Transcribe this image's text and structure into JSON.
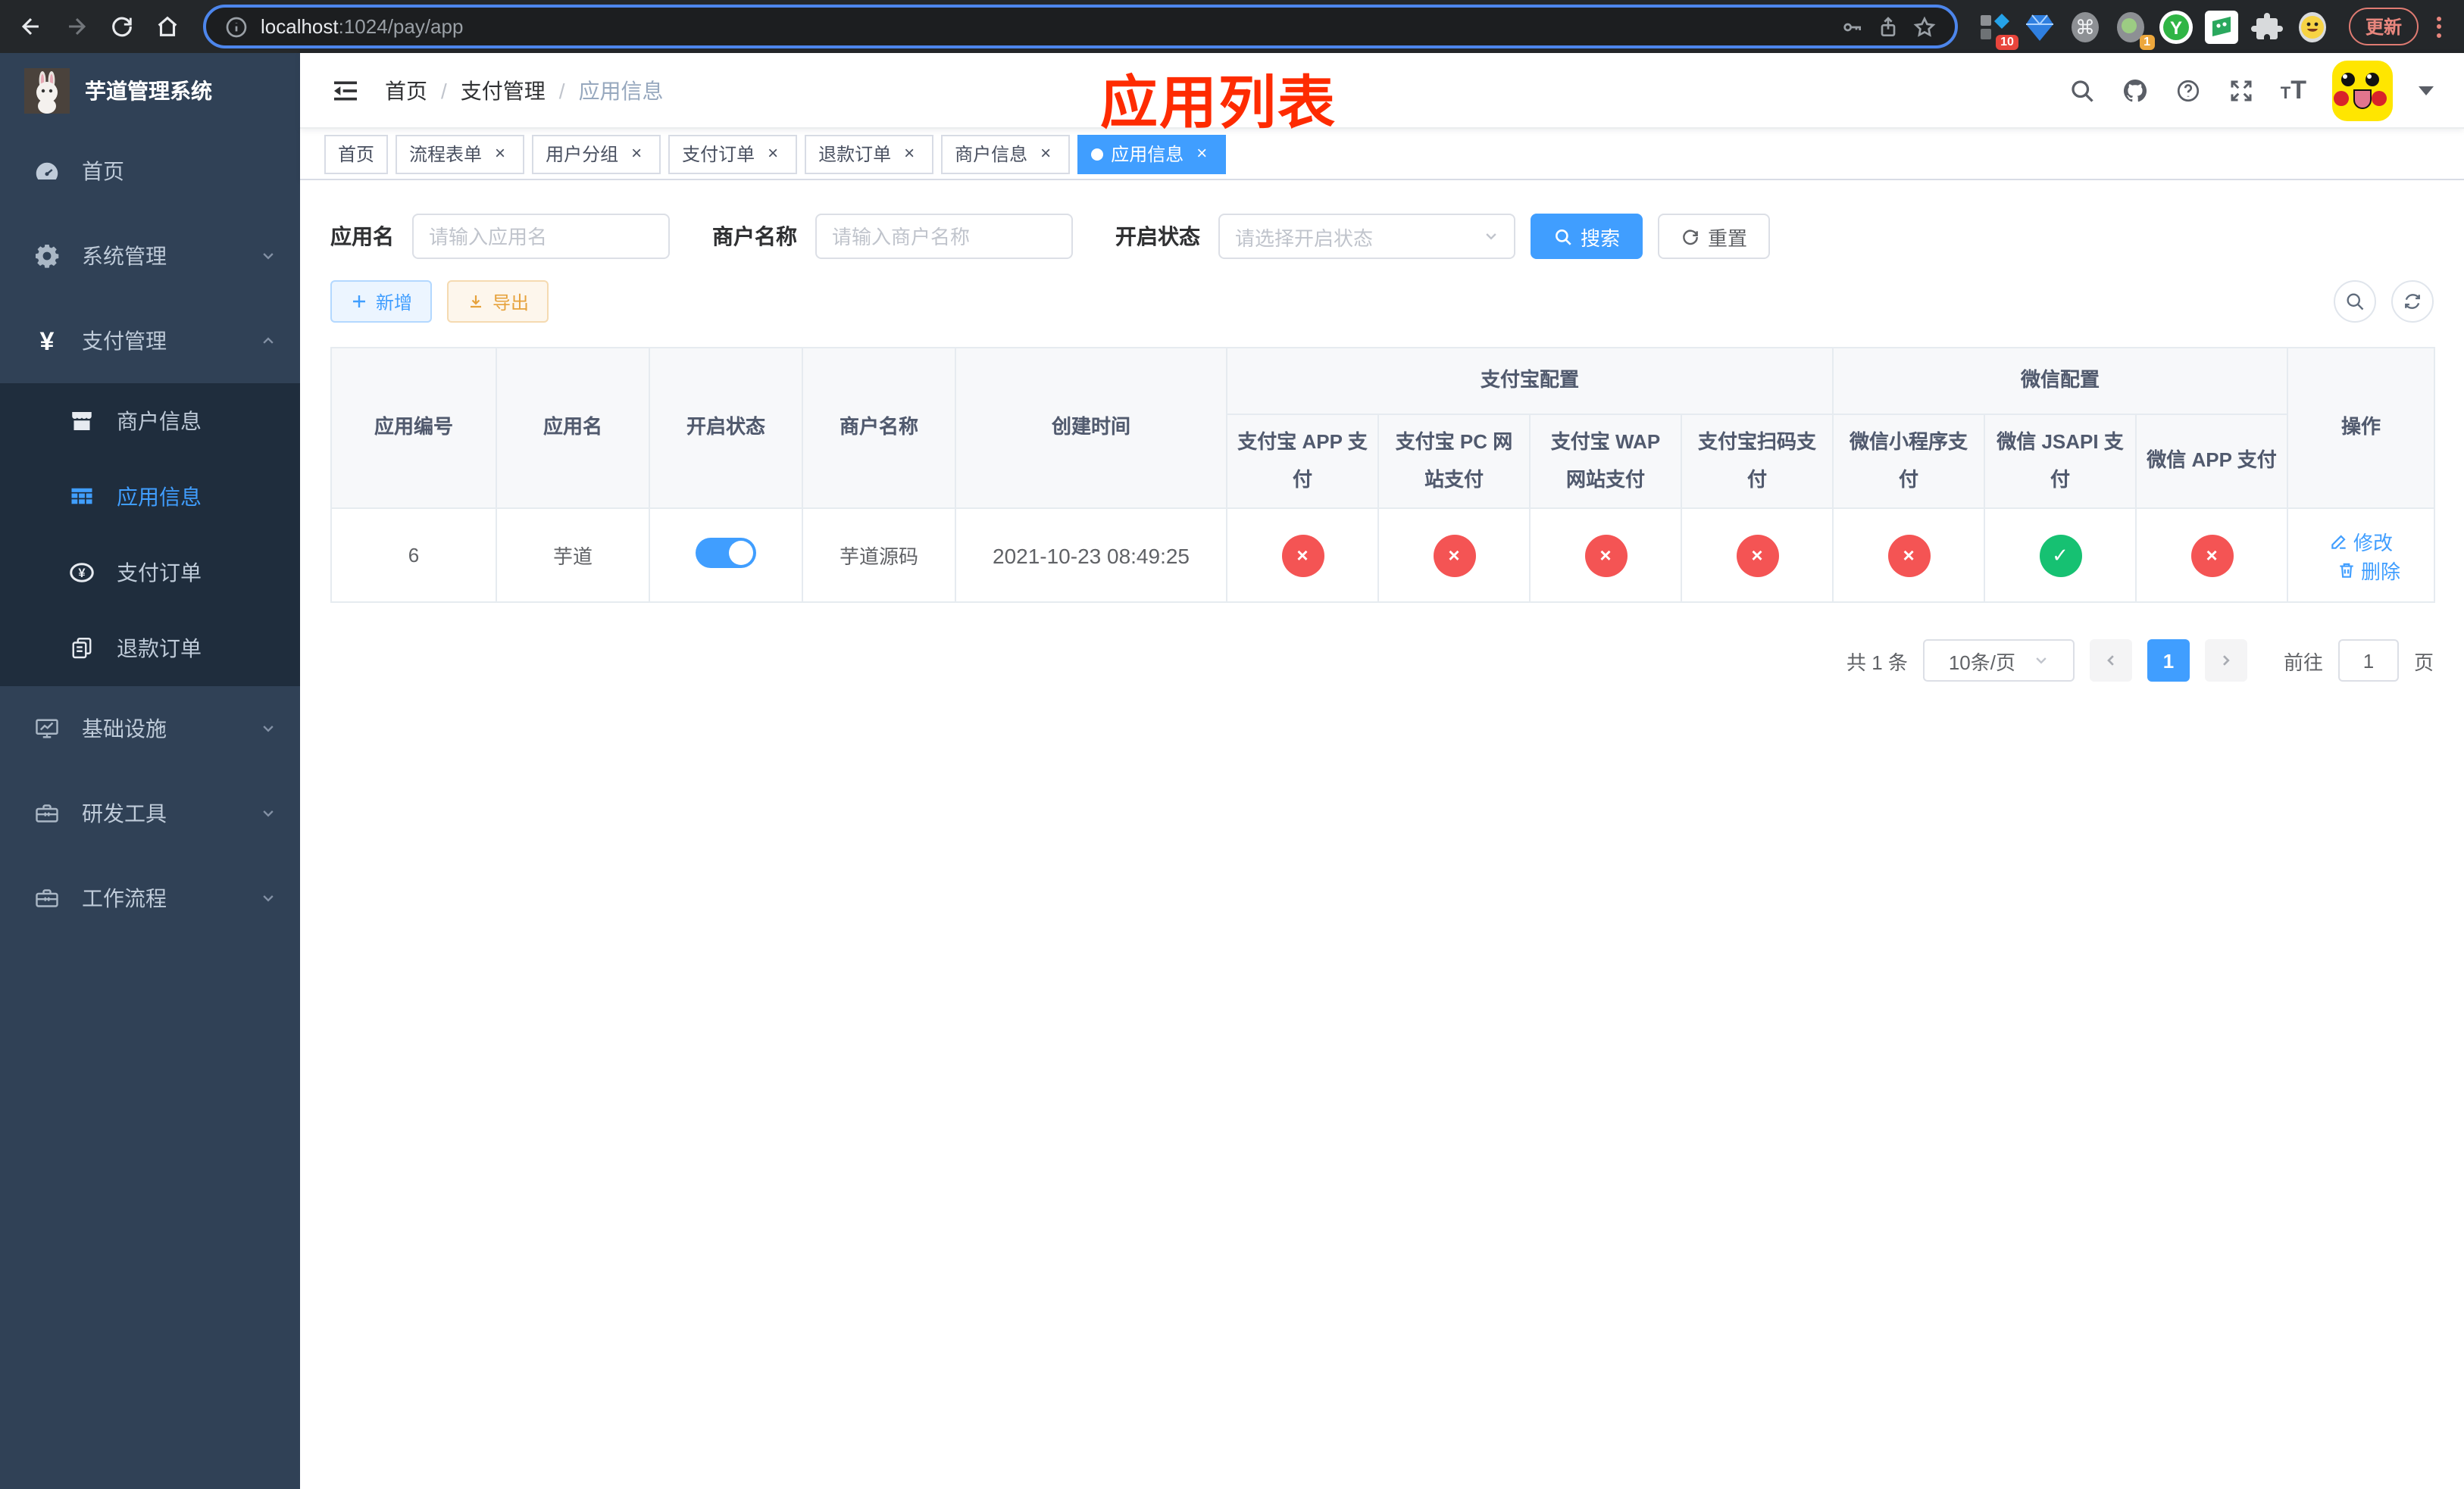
{
  "colors": {
    "accent": "#409eff",
    "success": "#16c172",
    "danger": "#f45454",
    "warning": "#e6a23c",
    "sidebar_bg": "#304156",
    "sidebar_submenu_bg": "#1f2d3d",
    "overlay_title_red": "#fe2b01",
    "url_focus_ring": "#4d86ec"
  },
  "browser": {
    "url_host": "localhost",
    "url_rest": ":1024/pay/app",
    "ext_badge_blocks": "10",
    "ext_badge_record": "1",
    "command_glyph": "⌘",
    "ext_y_label": "Y",
    "update_button": "更新"
  },
  "sidebar": {
    "title": "芋道管理系统",
    "items": [
      {
        "label": "首页"
      },
      {
        "label": "系统管理"
      },
      {
        "label": "支付管理"
      },
      {
        "label": "商户信息"
      },
      {
        "label": "应用信息"
      },
      {
        "label": "支付订单"
      },
      {
        "label": "退款订单"
      },
      {
        "label": "基础设施"
      },
      {
        "label": "研发工具"
      },
      {
        "label": "工作流程"
      }
    ]
  },
  "header": {
    "breadcrumb": [
      {
        "label": "首页"
      },
      {
        "label": "支付管理"
      },
      {
        "label": "应用信息"
      }
    ],
    "separator": "/",
    "overlay_title": "应用列表"
  },
  "tabs": [
    {
      "label": "首页"
    },
    {
      "label": "流程表单"
    },
    {
      "label": "用户分组"
    },
    {
      "label": "支付订单"
    },
    {
      "label": "退款订单"
    },
    {
      "label": "商户信息"
    },
    {
      "label": "应用信息"
    }
  ],
  "tab_close_glyph": "×",
  "filters": {
    "app_name_label": "应用名",
    "app_name_placeholder": "请输入应用名",
    "merchant_label": "商户名称",
    "merchant_placeholder": "请输入商户名称",
    "status_label": "开启状态",
    "status_placeholder": "请选择开启状态",
    "search_button": "搜索",
    "reset_button": "重置"
  },
  "actions": {
    "add": "新增",
    "export": "导出"
  },
  "table": {
    "columns": {
      "app_id": "应用编号",
      "app_name": "应用名",
      "status": "开启状态",
      "merchant": "商户名称",
      "create_time": "创建时间",
      "alipay_group": "支付宝配置",
      "wechat_group": "微信配置",
      "alipay_children": [
        "支付宝 APP 支付",
        "支付宝 PC 网站支付",
        "支付宝 WAP 网站支付",
        "支付宝扫码支付"
      ],
      "wechat_children": [
        "微信小程序支付",
        "微信 JSAPI 支付",
        "微信 APP 支付"
      ],
      "ops": "操作"
    },
    "rows": [
      {
        "app_id": "6",
        "app_name": "芋道",
        "status_on": true,
        "merchant": "芋道源码",
        "create_time": "2021-10-23 08:49:25",
        "channels": [
          "×",
          "×",
          "×",
          "×",
          "×",
          "✓",
          "×"
        ],
        "edit": "修改",
        "delete": "删除"
      }
    ]
  },
  "pagination": {
    "total": "共 1 条",
    "page_size": "10条/页",
    "current_page": "1",
    "goto_label": "前往",
    "goto_value": "1",
    "page_suffix": "页"
  }
}
